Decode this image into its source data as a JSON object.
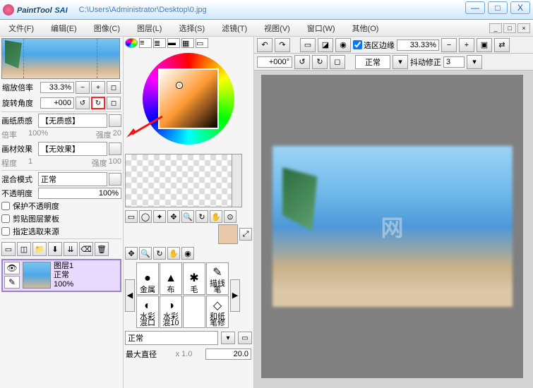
{
  "title": {
    "app": "PaintTool",
    "app2": "SAI",
    "path": "C:\\Users\\Administrator\\Desktop\\0.jpg"
  },
  "menu": {
    "file": "文件(F)",
    "edit": "编辑(E)",
    "image": "图像(C)",
    "layer": "图层(L)",
    "select": "选择(S)",
    "filter": "滤镜(T)",
    "view": "视图(V)",
    "window": "窗口(W)",
    "other": "其他(O)"
  },
  "nav": {
    "zoomLabel": "缩放倍率",
    "zoomVal": "33.3%",
    "rotLabel": "旋转角度",
    "rotVal": "+000"
  },
  "paper": {
    "texLabel": "画纸质感",
    "texVal": "【无质感】",
    "scaleLabel": "倍率",
    "scaleVal": "100%",
    "strLabel": "强度",
    "strVal": "20"
  },
  "effect": {
    "label": "画材效果",
    "val": "【无效果】",
    "degLabel": "程度",
    "degVal": "1",
    "strLabel": "强度",
    "strVal": "100"
  },
  "blend": {
    "modeLabel": "混合模式",
    "modeVal": "正常",
    "opLabel": "不透明度",
    "opVal": "100%"
  },
  "checks": {
    "protect": "保护不透明度",
    "clip": "剪贴图层蒙板",
    "source": "指定选取来源"
  },
  "layer": {
    "name": "图层1",
    "mode": "正常",
    "op": "100%"
  },
  "brushes": {
    "b1": "金属",
    "b2": "布",
    "b3": "毛",
    "b4": "描线笔",
    "b5": "水彩混口",
    "b6": "水彩混10",
    "b7": "",
    "b8": "和纸笔修"
  },
  "brushMode": {
    "modeVal": "正常"
  },
  "size": {
    "label": "最大直径",
    "x": "x 1.0",
    "val": "20.0"
  },
  "toolbar": {
    "selEdge": "选区边缘",
    "zoomVal": "33.33%",
    "angleVal": "+000°",
    "modeVal": "正常",
    "stabLabel": "抖动修正",
    "stabVal": "3"
  },
  "watermark": "网"
}
